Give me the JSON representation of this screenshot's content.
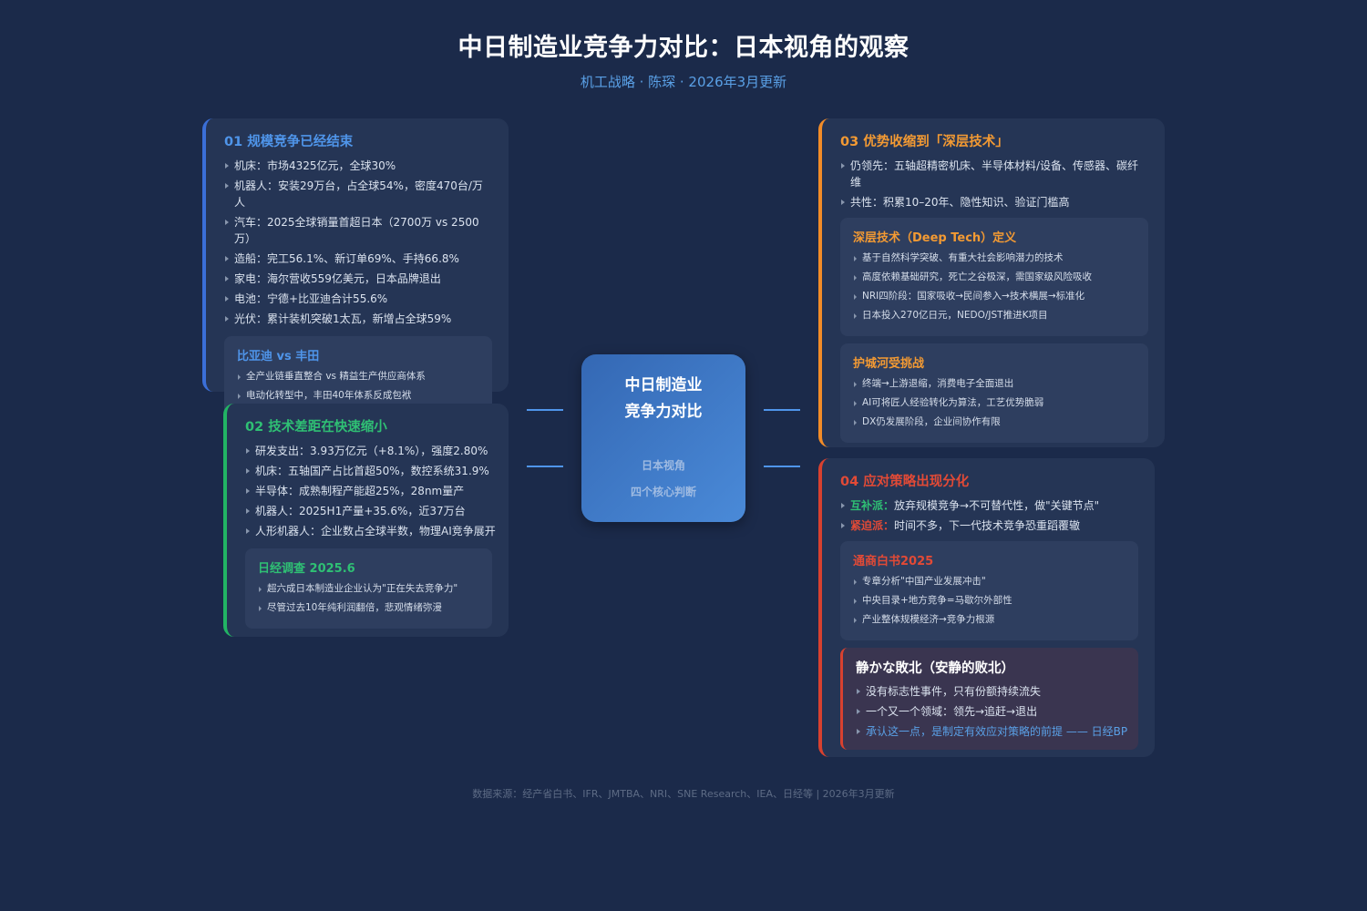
{
  "header": {
    "title": "中日制造业竞争力对比：日本视角的观察",
    "subtitle": "机工战略 · 陈琛 · 2026年3月更新"
  },
  "center": {
    "line1": "中日制造业",
    "line2": "竞争力对比",
    "sub1": "日本视角",
    "sub2": "四个核心判断"
  },
  "card1": {
    "title": "01 规模竞争已经结束",
    "items": [
      "机床：市场4325亿元，全球30%",
      "机器人：安装29万台，占全球54%，密度470台/万人",
      "汽车：2025全球销量首超日本（2700万 vs 2500万）",
      "造船：完工56.1%、新订单69%、手持66.8%",
      "家电：海尔营收559亿美元，日本品牌退出",
      "电池：宁德+比亚迪合计55.6%",
      "光伏：累计装机突破1太瓦，新增占全球59%"
    ],
    "sub": {
      "title": "比亚迪 vs 丰田",
      "items": [
        "全产业链垂直整合 vs 精益生产供应商体系",
        "电动化转型中，丰田40年体系反成包袱"
      ]
    }
  },
  "card2": {
    "title": "02 技术差距在快速缩小",
    "items": [
      "研发支出：3.93万亿元（+8.1%），强度2.80%",
      "机床：五轴国产占比首超50%，数控系统31.9%",
      "半导体：成熟制程产能超25%，28nm量产",
      "机器人：2025H1产量+35.6%，近37万台",
      "人形机器人：企业数占全球半数，物理AI竞争展开"
    ],
    "sub": {
      "title": "日经调查 2025.6",
      "items": [
        "超六成日本制造业企业认为\"正在失去竞争力\"",
        "尽管过去10年纯利润翻倍，悲观情绪弥漫"
      ]
    }
  },
  "card3": {
    "title": "03 优势收缩到「深层技术」",
    "items": [
      "仍领先：五轴超精密机床、半导体材料/设备、传感器、碳纤维",
      "共性：积累10–20年、隐性知识、验证门槛高"
    ],
    "sub1": {
      "title": "深层技术（Deep Tech）定义",
      "items": [
        "基于自然科学突破、有重大社会影响潜力的技术",
        "高度依赖基础研究，死亡之谷极深，需国家级风险吸收",
        "NRI四阶段：国家吸收→民间参入→技术横展→标准化",
        "日本投入270亿日元，NEDO/JST推进K项目"
      ]
    },
    "sub2": {
      "title": "护城河受挑战",
      "items": [
        "终端→上游退缩，消费电子全面退出",
        "AI可将匠人经验转化为算法，工艺优势脆弱",
        "DX仍发展阶段，企业间协作有限"
      ]
    }
  },
  "card4": {
    "title": "04 应对策略出现分化",
    "items": [
      {
        "tag": "互补派：",
        "text": "放弃规模竞争→不可替代性，做\"关键节点\""
      },
      {
        "tag": "紧迫派：",
        "text": "时间不多，下一代技术竞争恐重蹈覆辙"
      }
    ],
    "sub": {
      "title": "通商白书2025",
      "items": [
        "专章分析\"中国产业发展冲击\"",
        "中央目录+地方竞争=马歇尔外部性",
        "产业整体规模经济→竞争力根源"
      ]
    },
    "quiet": {
      "title": "静かな敗北（安静的败北）",
      "items": [
        "没有标志性事件，只有份额持续流失",
        "一个又一个领域：领先→追赶→退出"
      ],
      "highlight": "承认这一点，是制定有效应对策略的前提 —— 日经BP"
    }
  },
  "footer": {
    "text": "数据来源：经产省白书、IFR、JMTBA、NRI、SNE Research、IEA、日经等 | 2026年3月更新"
  },
  "colors": {
    "background": "#1b2a4a",
    "card": "#253555",
    "blue": "#4f95ea",
    "green": "#2fc074",
    "orange": "#f39a33",
    "red": "#e24a36"
  }
}
